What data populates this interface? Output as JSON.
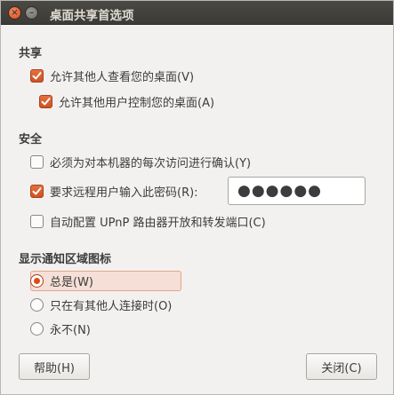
{
  "window": {
    "title": "桌面共享首选项",
    "close_glyph": "×",
    "minimize_glyph": "–"
  },
  "sharing": {
    "heading": "共享",
    "allow_view": {
      "label": "允许其他人查看您的桌面(V)",
      "checked": true
    },
    "allow_control": {
      "label": "允许其他用户控制您的桌面(A)",
      "checked": true
    }
  },
  "security": {
    "heading": "安全",
    "confirm_access": {
      "label": "必须为对本机器的每次访问进行确认(Y)",
      "checked": false
    },
    "require_password": {
      "label": "要求远程用户输入此密码(R):",
      "checked": true
    },
    "password_value": "●●●●●●",
    "upnp": {
      "label": "自动配置 UPnP 路由器开放和转发端口(C)",
      "checked": false
    }
  },
  "notification": {
    "heading": "显示通知区域图标",
    "always": {
      "label": "总是(W)",
      "selected": true
    },
    "only_connected": {
      "label": "只在有其他人连接时(O)",
      "selected": false
    },
    "never": {
      "label": "永不(N)",
      "selected": false
    }
  },
  "buttons": {
    "help": "帮助(H)",
    "close": "关闭(C)"
  },
  "colors": {
    "accent": "#df4a16",
    "titlebar": "#3c3b37",
    "background": "#f2f1f0"
  }
}
